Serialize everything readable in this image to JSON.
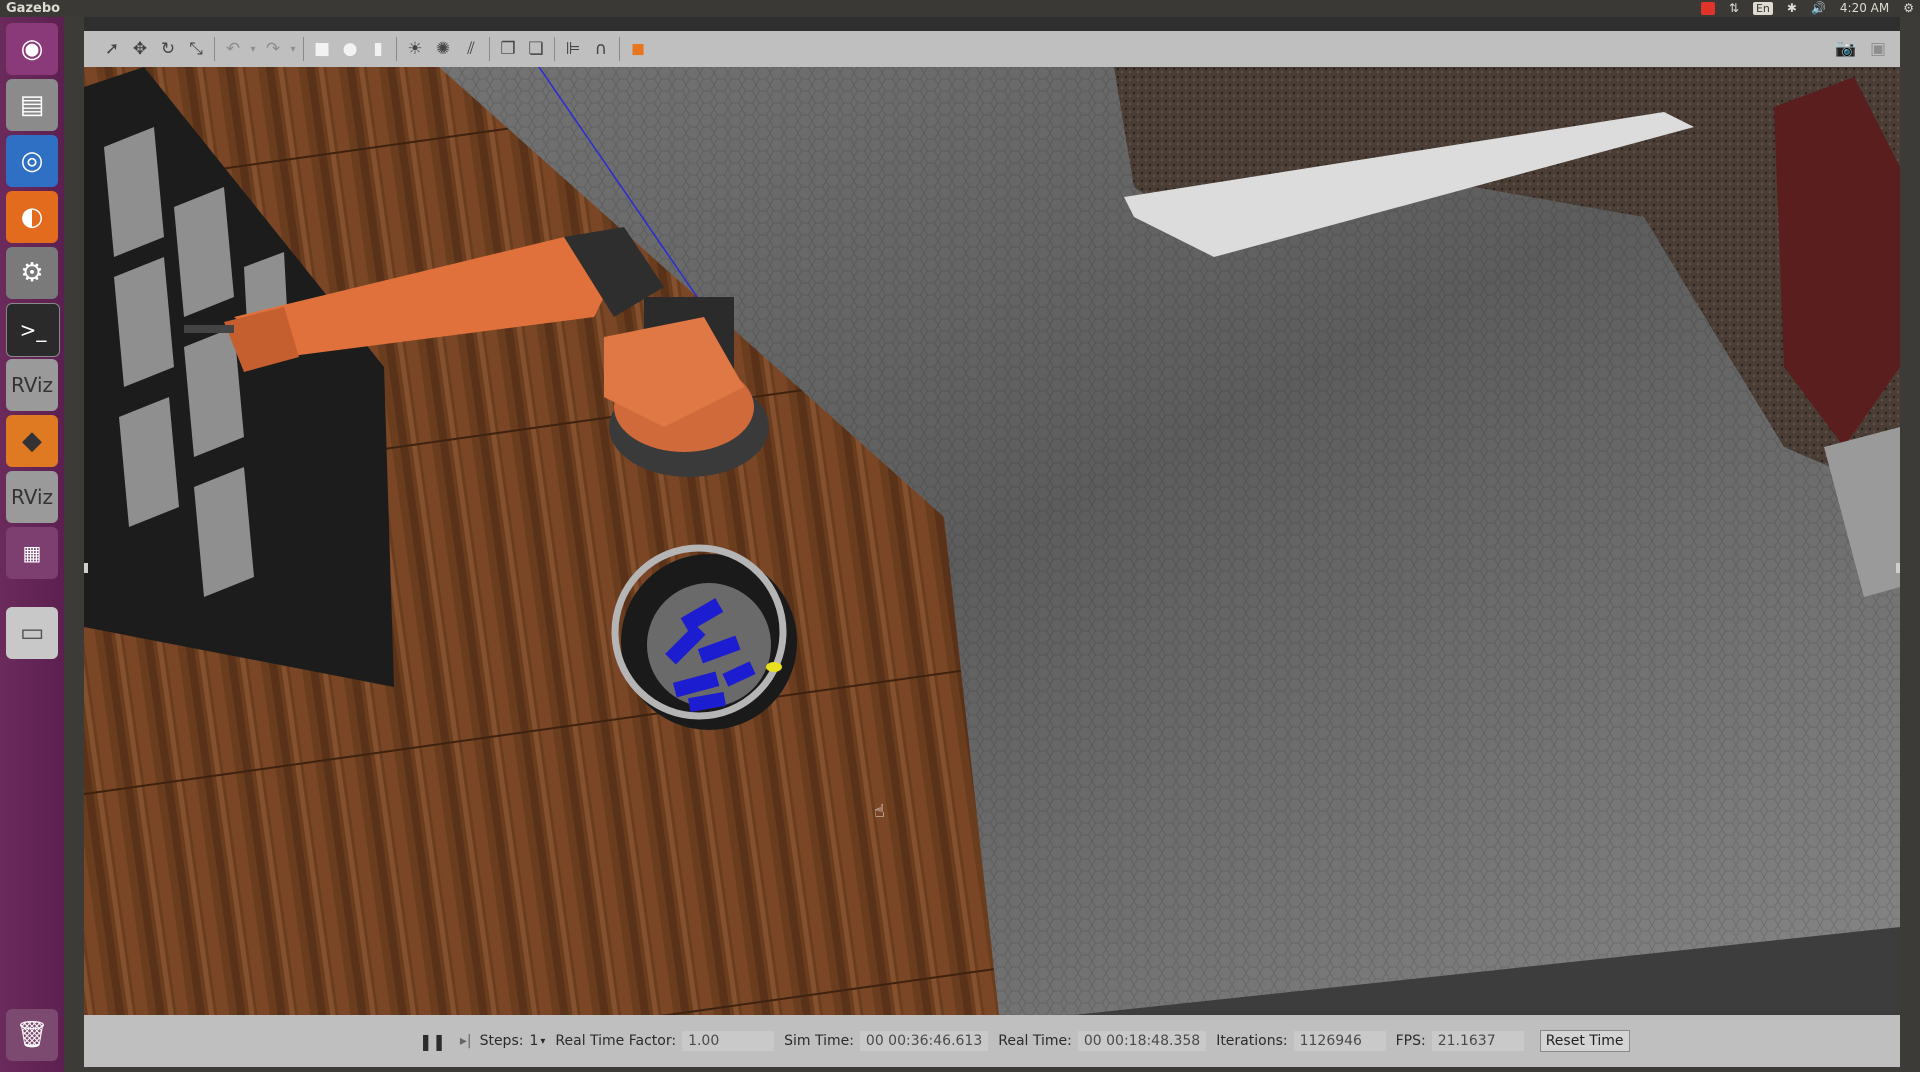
{
  "topbar": {
    "app_title": "Gazebo",
    "language": "En",
    "time": "4:20 AM"
  },
  "launcher": {
    "items": [
      {
        "name": "ubuntu-dash-icon"
      },
      {
        "name": "files-icon"
      },
      {
        "name": "chromium-icon"
      },
      {
        "name": "firefox-icon"
      },
      {
        "name": "system-settings-icon"
      },
      {
        "name": "terminal-icon"
      },
      {
        "name": "rviz-icon",
        "label": "RViz"
      },
      {
        "name": "gazebo-icon"
      },
      {
        "name": "rviz-icon",
        "label": "RViz"
      },
      {
        "name": "workspace-switcher-icon"
      },
      {
        "name": "drive-icon"
      },
      {
        "name": "trash-icon"
      }
    ]
  },
  "toolbar": {
    "tools": [
      "select-icon",
      "translate-icon",
      "rotate-icon",
      "scale-icon",
      "undo-icon",
      "redo-icon",
      "box-icon",
      "sphere-icon",
      "cylinder-icon",
      "point-light-icon",
      "spot-light-icon",
      "directional-light-icon",
      "copy-icon",
      "paste-icon",
      "align-icon",
      "snap-icon",
      "view-angle-icon"
    ],
    "right_tools": [
      "screenshot-icon",
      "record-icon"
    ]
  },
  "status": {
    "steps_label": "Steps:",
    "steps_value": "1",
    "rtf_label": "Real Time Factor:",
    "rtf_value": "1.00",
    "sim_time_label": "Sim Time:",
    "sim_time_value": "00 00:36:46.613",
    "real_time_label": "Real Time:",
    "real_time_value": "00 00:18:48.358",
    "iterations_label": "Iterations:",
    "iterations_value": "1126946",
    "fps_label": "FPS:",
    "fps_value": "21.1637",
    "reset_label": "Reset Time"
  }
}
